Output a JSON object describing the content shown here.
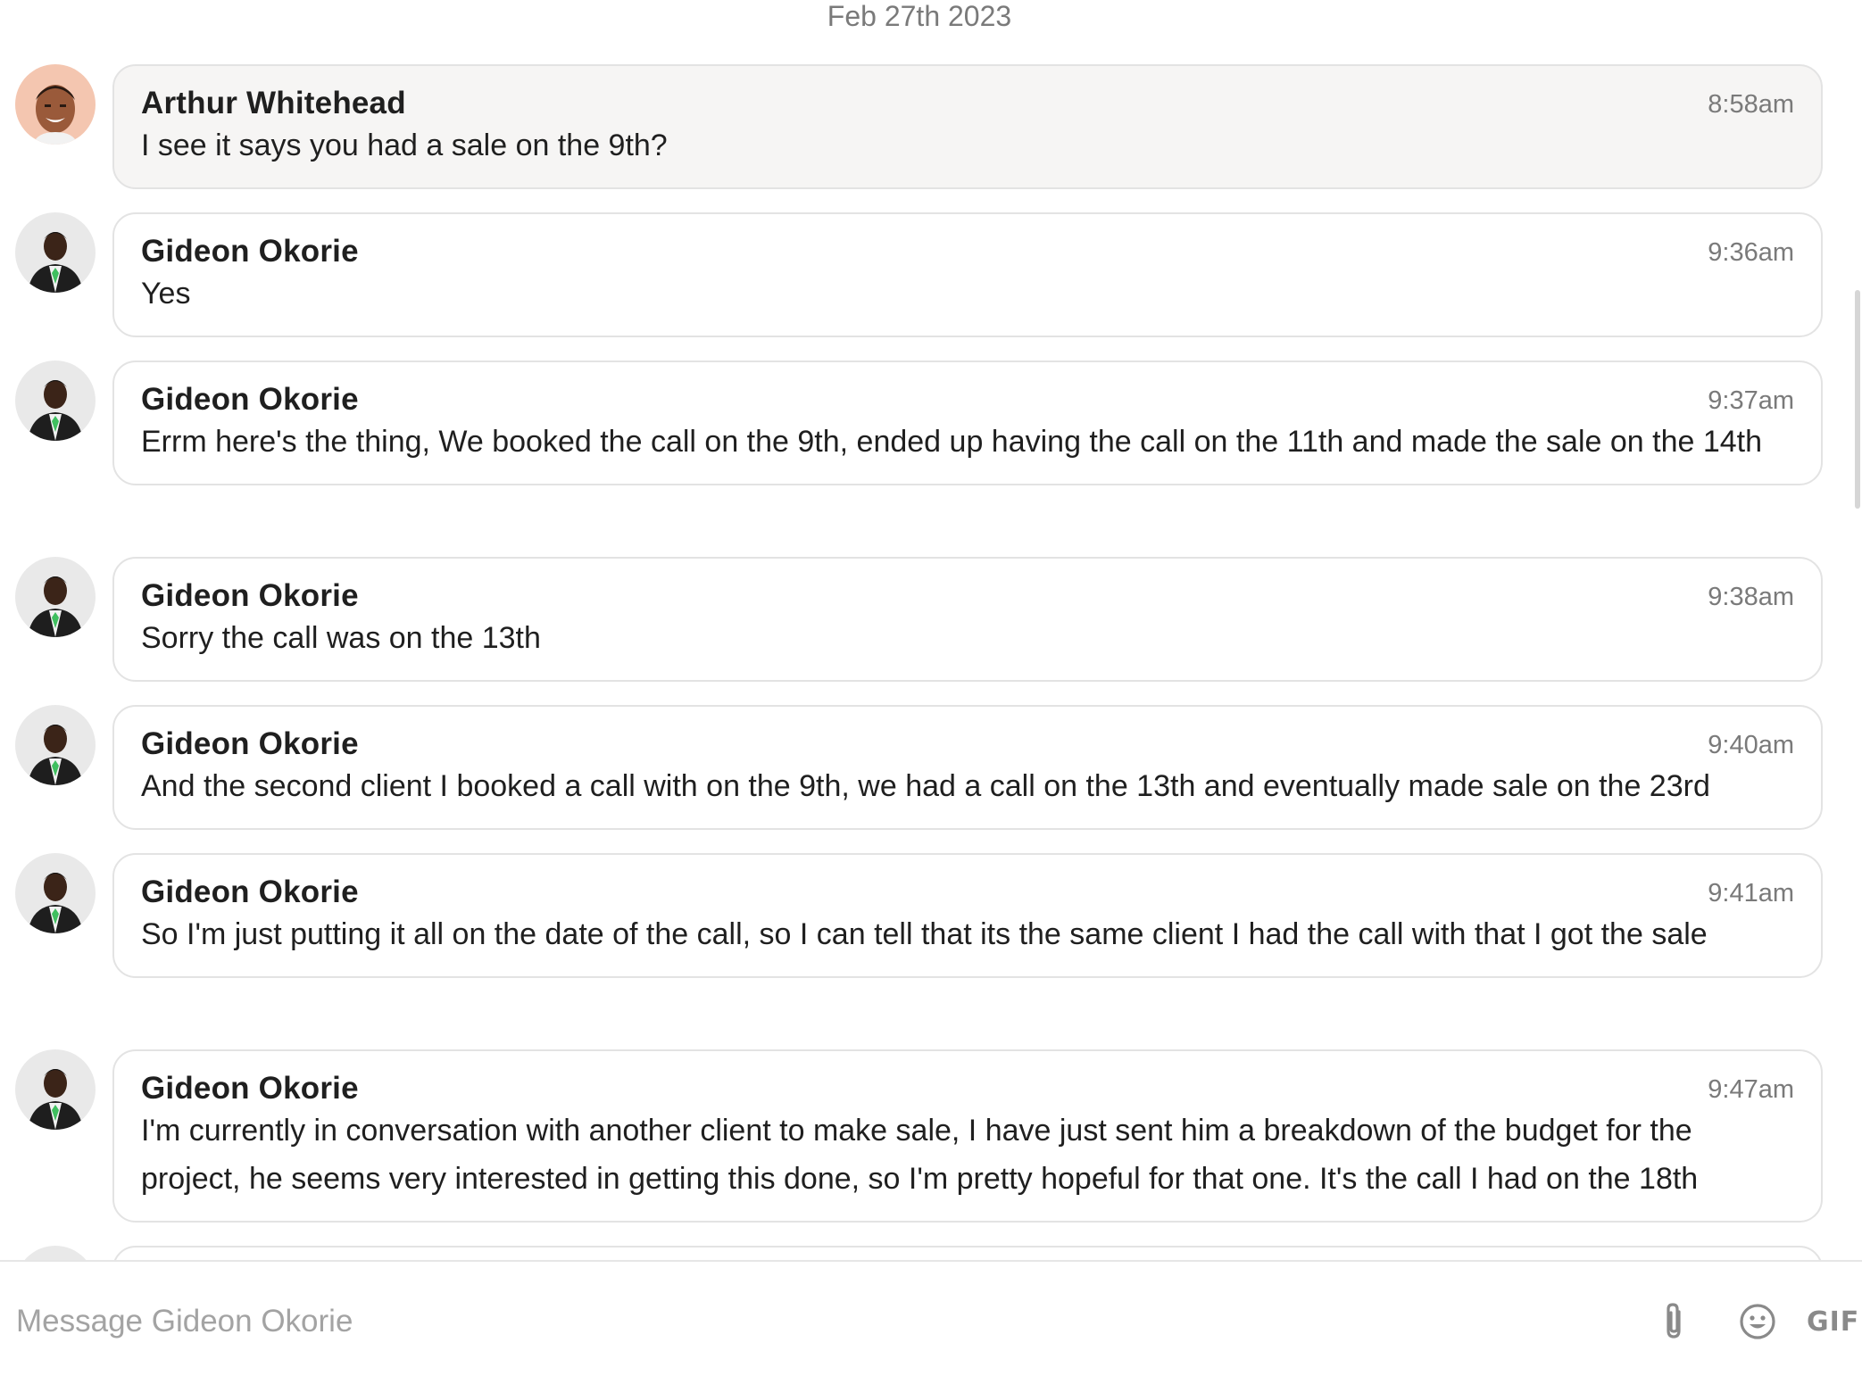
{
  "conversation": {
    "date_separator": "Feb 27th 2023"
  },
  "messages": [
    {
      "sender": "Arthur Whitehead",
      "time": "8:58am",
      "text": "I see it says you had a sale on the 9th?",
      "highlighted": true,
      "avatar": "arthur-avatar"
    },
    {
      "sender": "Gideon Okorie",
      "time": "9:36am",
      "text": "Yes",
      "highlighted": false,
      "avatar": "gideon-avatar"
    },
    {
      "sender": "Gideon Okorie",
      "time": "9:37am",
      "text": "Errm here's the thing, We booked the call on the 9th, ended up having the call on the 11th and made the sale on the 14th",
      "highlighted": false,
      "avatar": "gideon-avatar"
    },
    {
      "sender": "Gideon Okorie",
      "time": "9:38am",
      "text": "Sorry the call was on the 13th",
      "highlighted": false,
      "avatar": "gideon-avatar"
    },
    {
      "sender": "Gideon Okorie",
      "time": "9:40am",
      "text": "And the second client I booked a call with on the 9th, we had a call on the 13th and eventually made sale on the 23rd",
      "highlighted": false,
      "avatar": "gideon-avatar"
    },
    {
      "sender": "Gideon Okorie",
      "time": "9:41am",
      "text": "So I'm just putting it all on the date of the call, so I can tell that its the same client I had the call with that I got the sale",
      "highlighted": false,
      "avatar": "gideon-avatar"
    },
    {
      "sender": "Gideon Okorie",
      "time": "9:47am",
      "text": "I'm currently in conversation with another client to make sale, I have just sent him a breakdown of the budget for the project, he seems very interested in getting this done, so I'm pretty hopeful for that one. It's the call I had on the 18th",
      "highlighted": false,
      "avatar": "gideon-avatar"
    }
  ],
  "composer": {
    "placeholder": "Message Gideon Okorie",
    "value": "",
    "attach_icon": "paperclip-icon",
    "emoji_icon": "smiley-icon",
    "gif_label": "GIF"
  },
  "colors": {
    "bubble_border": "#e3e3e3",
    "highlight_bubble_bg": "#f6f5f4",
    "muted_text": "#7a7a7a",
    "placeholder_text": "#a3a3a3",
    "primary_text": "#1f1f1f"
  }
}
